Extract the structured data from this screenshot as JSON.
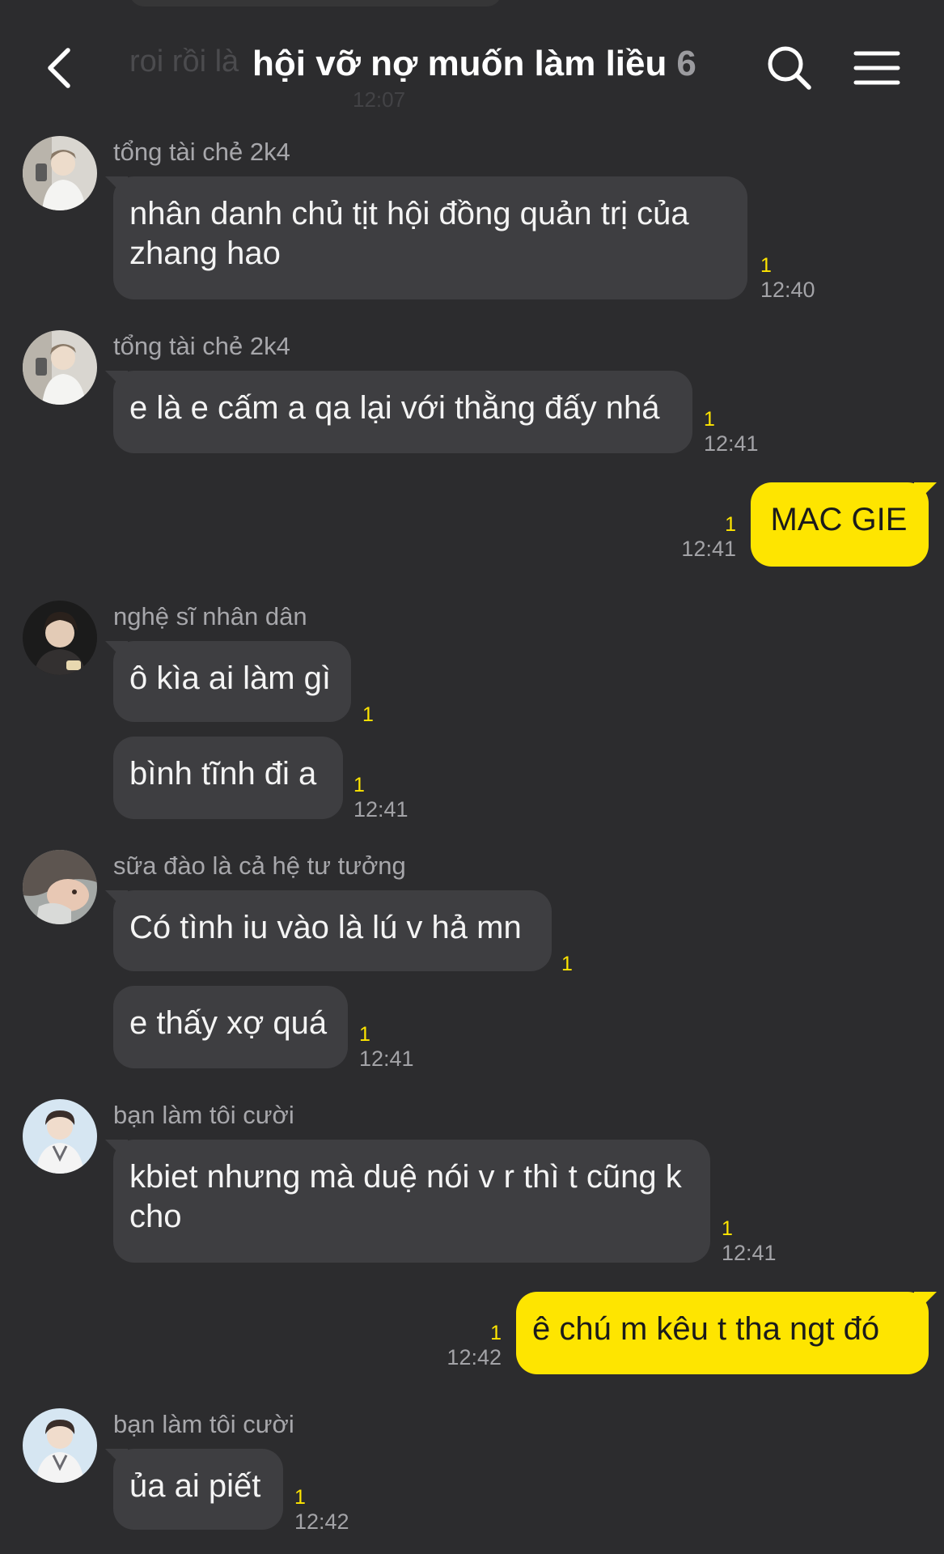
{
  "header": {
    "title": "hội vỡ nợ muốn làm liều",
    "member_count": "6"
  },
  "ghost": {
    "text": "roi rồi là",
    "time": "12:07"
  },
  "messages": [
    {
      "sender": "tổng tài chẻ 2k4",
      "text": "nhân danh chủ tịt hội đồng quản trị của zhang hao",
      "unread": "1",
      "time": "12:40"
    },
    {
      "sender": "tổng tài chẻ 2k4",
      "text": "e là e cấm a qa lại với thằng đấy nhá",
      "unread": "1",
      "time": "12:41"
    },
    {
      "text": "MAC GIE",
      "unread": "1",
      "time": "12:41"
    },
    {
      "sender": "nghệ sĩ nhân dân",
      "text": "ô kìa ai làm gì",
      "unread": "1"
    },
    {
      "text": "bình tĩnh đi a",
      "unread": "1",
      "time": "12:41"
    },
    {
      "sender": "sữa đào là cả hệ tư tưởng",
      "text": "Có tình iu vào là lú v hả mn",
      "unread": "1"
    },
    {
      "text": "e thấy xợ quá",
      "unread": "1",
      "time": "12:41"
    },
    {
      "sender": "bạn làm tôi cười",
      "text": "kbiet nhưng mà duệ nói v r thì t cũng k cho",
      "unread": "1",
      "time": "12:41"
    },
    {
      "text": "ê chú m kêu t tha ngt đó",
      "unread": "1",
      "time": "12:42"
    },
    {
      "sender": "bạn làm tôi cười",
      "text": "ủa ai piết",
      "unread": "1",
      "time": "12:42"
    }
  ],
  "colors": {
    "background": "#2c2c2e",
    "bubble_other": "#3e3e41",
    "bubble_mine": "#fee500",
    "unread": "#fee500"
  },
  "icons": {
    "back": "chevron-left-icon",
    "search": "search-icon",
    "menu": "hamburger-menu-icon"
  }
}
